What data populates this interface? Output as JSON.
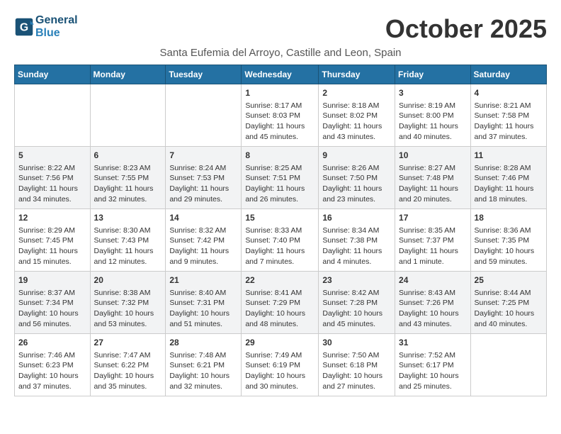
{
  "header": {
    "logo_line1": "General",
    "logo_line2": "Blue",
    "month_title": "October 2025",
    "location": "Santa Eufemia del Arroyo, Castille and Leon, Spain"
  },
  "columns": [
    "Sunday",
    "Monday",
    "Tuesday",
    "Wednesday",
    "Thursday",
    "Friday",
    "Saturday"
  ],
  "weeks": [
    [
      {
        "day": "",
        "content": ""
      },
      {
        "day": "",
        "content": ""
      },
      {
        "day": "",
        "content": ""
      },
      {
        "day": "1",
        "content": "Sunrise: 8:17 AM\nSunset: 8:03 PM\nDaylight: 11 hours and 45 minutes."
      },
      {
        "day": "2",
        "content": "Sunrise: 8:18 AM\nSunset: 8:02 PM\nDaylight: 11 hours and 43 minutes."
      },
      {
        "day": "3",
        "content": "Sunrise: 8:19 AM\nSunset: 8:00 PM\nDaylight: 11 hours and 40 minutes."
      },
      {
        "day": "4",
        "content": "Sunrise: 8:21 AM\nSunset: 7:58 PM\nDaylight: 11 hours and 37 minutes."
      }
    ],
    [
      {
        "day": "5",
        "content": "Sunrise: 8:22 AM\nSunset: 7:56 PM\nDaylight: 11 hours and 34 minutes."
      },
      {
        "day": "6",
        "content": "Sunrise: 8:23 AM\nSunset: 7:55 PM\nDaylight: 11 hours and 32 minutes."
      },
      {
        "day": "7",
        "content": "Sunrise: 8:24 AM\nSunset: 7:53 PM\nDaylight: 11 hours and 29 minutes."
      },
      {
        "day": "8",
        "content": "Sunrise: 8:25 AM\nSunset: 7:51 PM\nDaylight: 11 hours and 26 minutes."
      },
      {
        "day": "9",
        "content": "Sunrise: 8:26 AM\nSunset: 7:50 PM\nDaylight: 11 hours and 23 minutes."
      },
      {
        "day": "10",
        "content": "Sunrise: 8:27 AM\nSunset: 7:48 PM\nDaylight: 11 hours and 20 minutes."
      },
      {
        "day": "11",
        "content": "Sunrise: 8:28 AM\nSunset: 7:46 PM\nDaylight: 11 hours and 18 minutes."
      }
    ],
    [
      {
        "day": "12",
        "content": "Sunrise: 8:29 AM\nSunset: 7:45 PM\nDaylight: 11 hours and 15 minutes."
      },
      {
        "day": "13",
        "content": "Sunrise: 8:30 AM\nSunset: 7:43 PM\nDaylight: 11 hours and 12 minutes."
      },
      {
        "day": "14",
        "content": "Sunrise: 8:32 AM\nSunset: 7:42 PM\nDaylight: 11 hours and 9 minutes."
      },
      {
        "day": "15",
        "content": "Sunrise: 8:33 AM\nSunset: 7:40 PM\nDaylight: 11 hours and 7 minutes."
      },
      {
        "day": "16",
        "content": "Sunrise: 8:34 AM\nSunset: 7:38 PM\nDaylight: 11 hours and 4 minutes."
      },
      {
        "day": "17",
        "content": "Sunrise: 8:35 AM\nSunset: 7:37 PM\nDaylight: 11 hours and 1 minute."
      },
      {
        "day": "18",
        "content": "Sunrise: 8:36 AM\nSunset: 7:35 PM\nDaylight: 10 hours and 59 minutes."
      }
    ],
    [
      {
        "day": "19",
        "content": "Sunrise: 8:37 AM\nSunset: 7:34 PM\nDaylight: 10 hours and 56 minutes."
      },
      {
        "day": "20",
        "content": "Sunrise: 8:38 AM\nSunset: 7:32 PM\nDaylight: 10 hours and 53 minutes."
      },
      {
        "day": "21",
        "content": "Sunrise: 8:40 AM\nSunset: 7:31 PM\nDaylight: 10 hours and 51 minutes."
      },
      {
        "day": "22",
        "content": "Sunrise: 8:41 AM\nSunset: 7:29 PM\nDaylight: 10 hours and 48 minutes."
      },
      {
        "day": "23",
        "content": "Sunrise: 8:42 AM\nSunset: 7:28 PM\nDaylight: 10 hours and 45 minutes."
      },
      {
        "day": "24",
        "content": "Sunrise: 8:43 AM\nSunset: 7:26 PM\nDaylight: 10 hours and 43 minutes."
      },
      {
        "day": "25",
        "content": "Sunrise: 8:44 AM\nSunset: 7:25 PM\nDaylight: 10 hours and 40 minutes."
      }
    ],
    [
      {
        "day": "26",
        "content": "Sunrise: 7:46 AM\nSunset: 6:23 PM\nDaylight: 10 hours and 37 minutes."
      },
      {
        "day": "27",
        "content": "Sunrise: 7:47 AM\nSunset: 6:22 PM\nDaylight: 10 hours and 35 minutes."
      },
      {
        "day": "28",
        "content": "Sunrise: 7:48 AM\nSunset: 6:21 PM\nDaylight: 10 hours and 32 minutes."
      },
      {
        "day": "29",
        "content": "Sunrise: 7:49 AM\nSunset: 6:19 PM\nDaylight: 10 hours and 30 minutes."
      },
      {
        "day": "30",
        "content": "Sunrise: 7:50 AM\nSunset: 6:18 PM\nDaylight: 10 hours and 27 minutes."
      },
      {
        "day": "31",
        "content": "Sunrise: 7:52 AM\nSunset: 6:17 PM\nDaylight: 10 hours and 25 minutes."
      },
      {
        "day": "",
        "content": ""
      }
    ]
  ]
}
